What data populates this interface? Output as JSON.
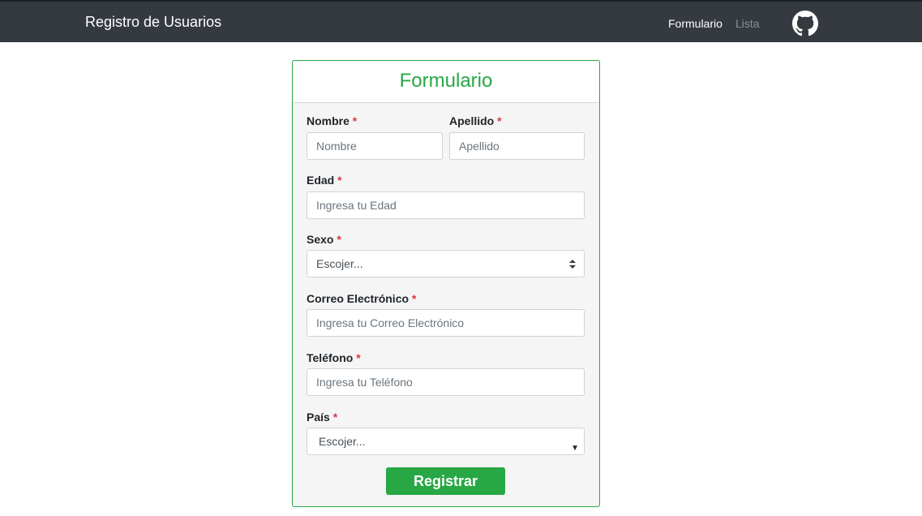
{
  "navbar": {
    "brand": "Registro de Usuarios",
    "links": [
      {
        "label": "Formulario",
        "active": true
      },
      {
        "label": "Lista",
        "active": false
      }
    ],
    "github_icon": "github-icon"
  },
  "form": {
    "title": "Formulario",
    "required_mark": "*",
    "fields": {
      "nombre": {
        "label": "Nombre",
        "placeholder": "Nombre",
        "value": ""
      },
      "apellido": {
        "label": "Apellido",
        "placeholder": "Apellido",
        "value": ""
      },
      "edad": {
        "label": "Edad",
        "placeholder": "Ingresa tu Edad",
        "value": ""
      },
      "sexo": {
        "label": "Sexo",
        "selected": "Escojer..."
      },
      "correo": {
        "label": "Correo Electrónico",
        "placeholder": "Ingresa tu Correo Electrónico",
        "value": ""
      },
      "telefono": {
        "label": "Teléfono",
        "placeholder": "Ingresa tu Teléfono",
        "value": ""
      },
      "pais": {
        "label": "País",
        "selected": "Escojer..."
      }
    },
    "submit_label": "Registrar"
  },
  "colors": {
    "navbar_bg": "#343a40",
    "accent": "#28a745",
    "required": "#dc3545",
    "card_bg": "#f5f5f5"
  }
}
